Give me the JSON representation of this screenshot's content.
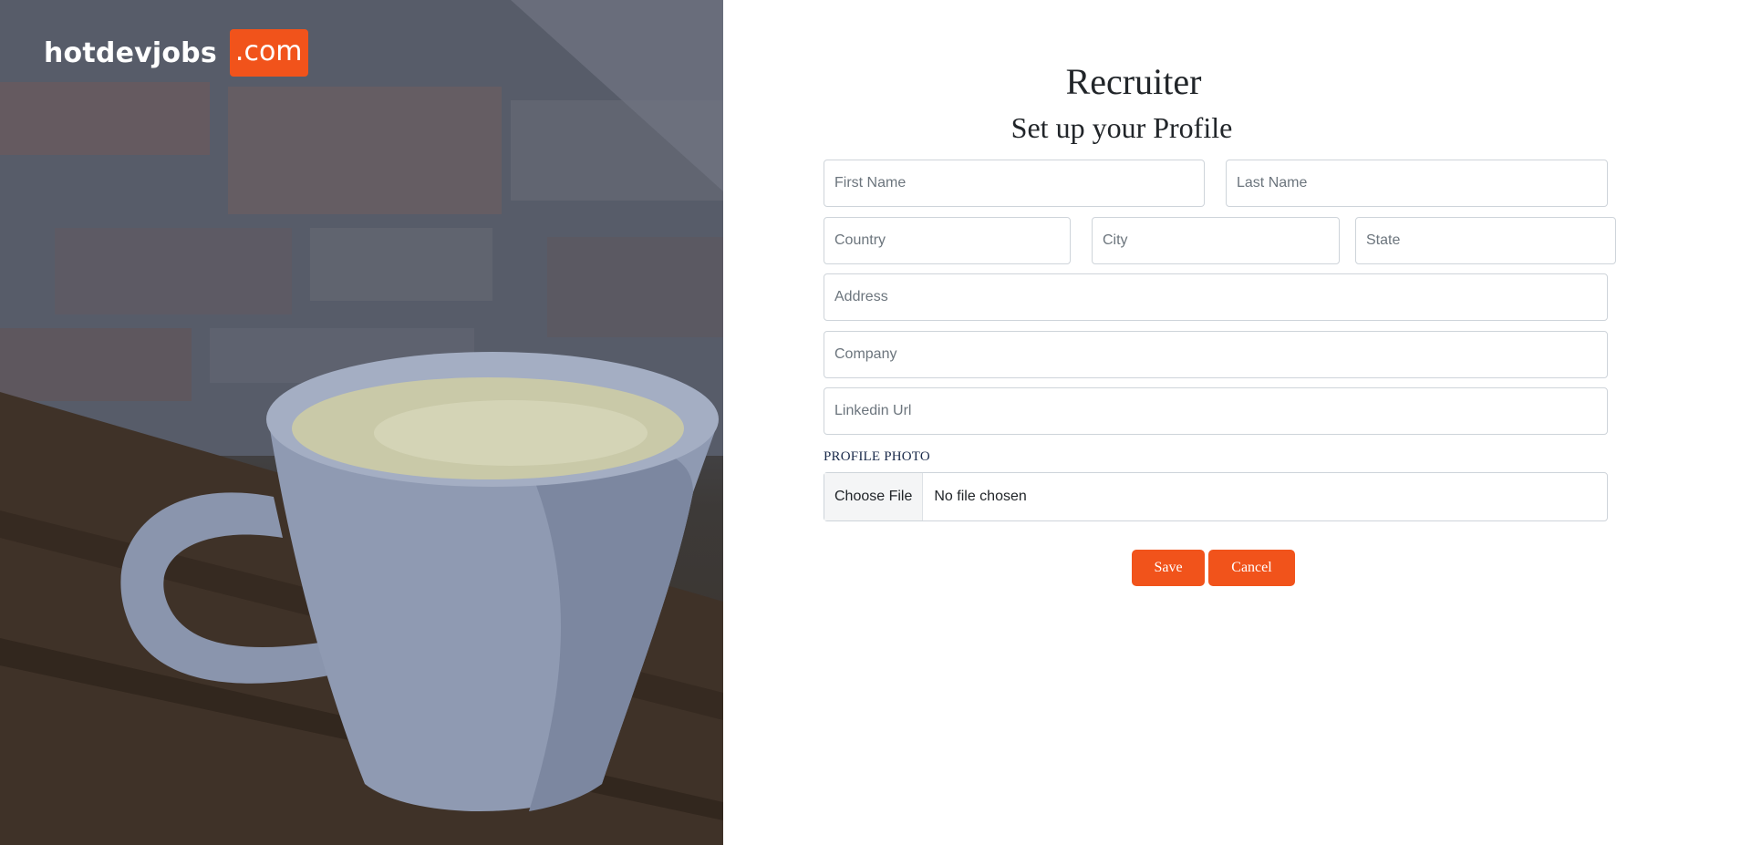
{
  "brand": {
    "name": "hotdevjobs",
    "badge": ".com",
    "accent_color": "#f1531b"
  },
  "form": {
    "title": "Recruiter",
    "subtitle": "Set up your Profile",
    "fields": {
      "first_name": {
        "placeholder": "First Name",
        "value": ""
      },
      "last_name": {
        "placeholder": "Last Name",
        "value": ""
      },
      "country": {
        "placeholder": "Country",
        "value": ""
      },
      "city": {
        "placeholder": "City",
        "value": ""
      },
      "state": {
        "placeholder": "State",
        "value": ""
      },
      "address": {
        "placeholder": "Address",
        "value": ""
      },
      "company": {
        "placeholder": "Company",
        "value": ""
      },
      "linkedin": {
        "placeholder": "Linkedin Url",
        "value": ""
      }
    },
    "photo_label": "PROFILE PHOTO",
    "file_button": "Choose File",
    "file_status": "No file chosen",
    "save_label": "Save",
    "cancel_label": "Cancel"
  },
  "hero": {
    "image_subject": "coffee-cup-photo"
  }
}
